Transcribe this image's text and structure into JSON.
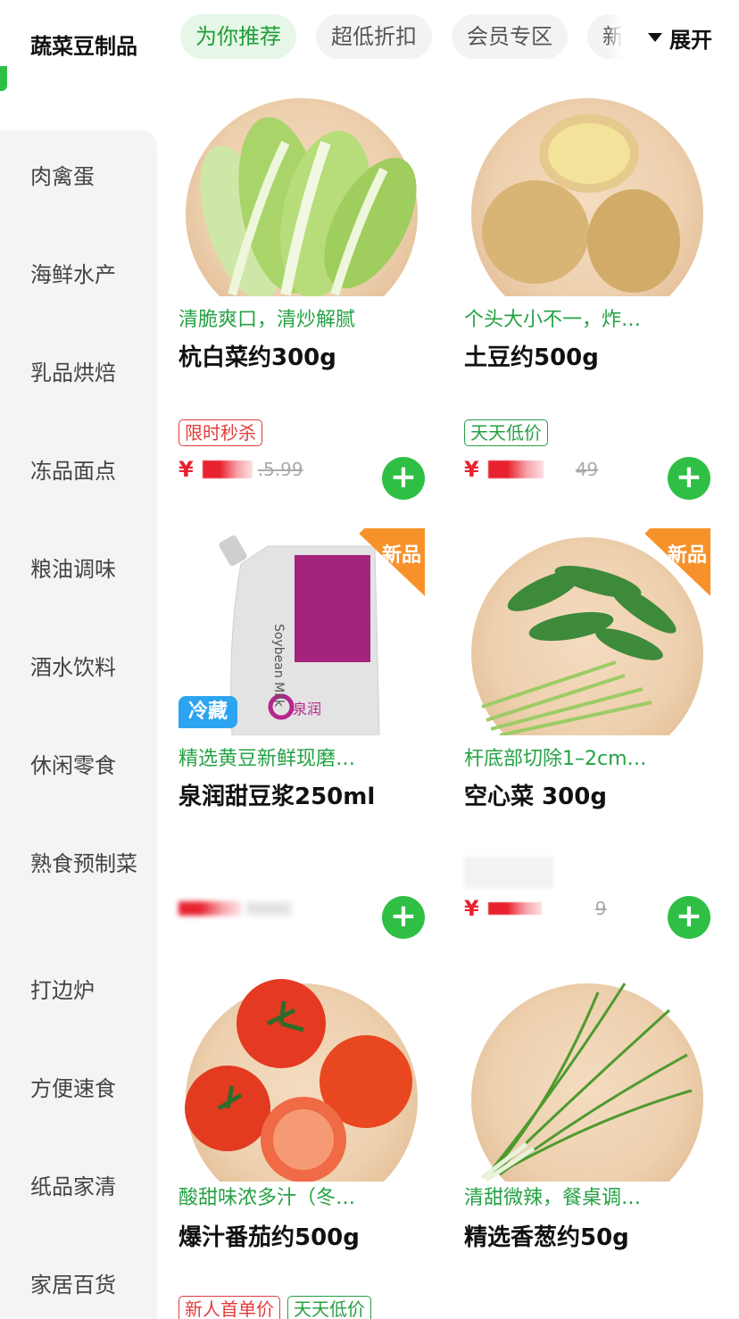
{
  "sidebar": {
    "items": [
      {
        "label": "蔬菜豆制品",
        "active": true
      },
      {
        "label": "肉禽蛋"
      },
      {
        "label": "海鲜水产"
      },
      {
        "label": "乳品烘焙"
      },
      {
        "label": "冻品面点"
      },
      {
        "label": "粮油调味"
      },
      {
        "label": "酒水饮料"
      },
      {
        "label": "休闲零食"
      },
      {
        "label": "熟食预制菜"
      },
      {
        "label": "打边炉"
      },
      {
        "label": "方便速食"
      },
      {
        "label": "纸品家清"
      },
      {
        "label": "家居百货"
      }
    ]
  },
  "tabs": {
    "items": [
      "为你推荐",
      "超低折扣",
      "会员专区",
      "新"
    ],
    "active_index": 0,
    "expand_label": "展开"
  },
  "products": [
    {
      "slogan": "清脆爽口，清炒解腻",
      "name": "杭白菜约300g",
      "tags": [
        "限时秒杀"
      ],
      "tag_colors": [
        "red"
      ],
      "currency": "¥",
      "old_price": ".5.99",
      "image": "napa-cabbage"
    },
    {
      "slogan": "个头大小不一，炸…",
      "name": "土豆约500g",
      "tags": [
        "天天低价"
      ],
      "tag_colors": [
        "green"
      ],
      "currency": "¥",
      "old_price": "49",
      "image": "potatoes"
    },
    {
      "slogan": "精选黄豆新鲜现磨…",
      "name": "泉润甜豆浆250ml",
      "badge": "新品",
      "cold_label": "冷藏",
      "image": "soy-milk-pouch",
      "pouch_brand": "泉润",
      "pouch_text": "Soybean Milk"
    },
    {
      "slogan": "杆底部切除1–2cm…",
      "name": "空心菜 300g",
      "badge": "新品",
      "currency": "¥",
      "old_price": "9",
      "image": "water-spinach"
    },
    {
      "slogan": "酸甜味浓多汁（冬…",
      "name": "爆汁番茄约500g",
      "tags": [
        "新人首单价"
      ],
      "tag_colors": [
        "red"
      ],
      "image": "tomatoes"
    },
    {
      "slogan": "清甜微辣，餐桌调…",
      "name": "精选香葱约50g",
      "tags": [
        "天天低价"
      ],
      "tag_colors": [
        "green"
      ],
      "image": "scallions"
    }
  ],
  "colors": {
    "accent": "#2fbf45",
    "slogan": "#25a244",
    "price": "#e8232f",
    "new_badge": "#f7922a",
    "cold_badge": "#2da4ef"
  }
}
